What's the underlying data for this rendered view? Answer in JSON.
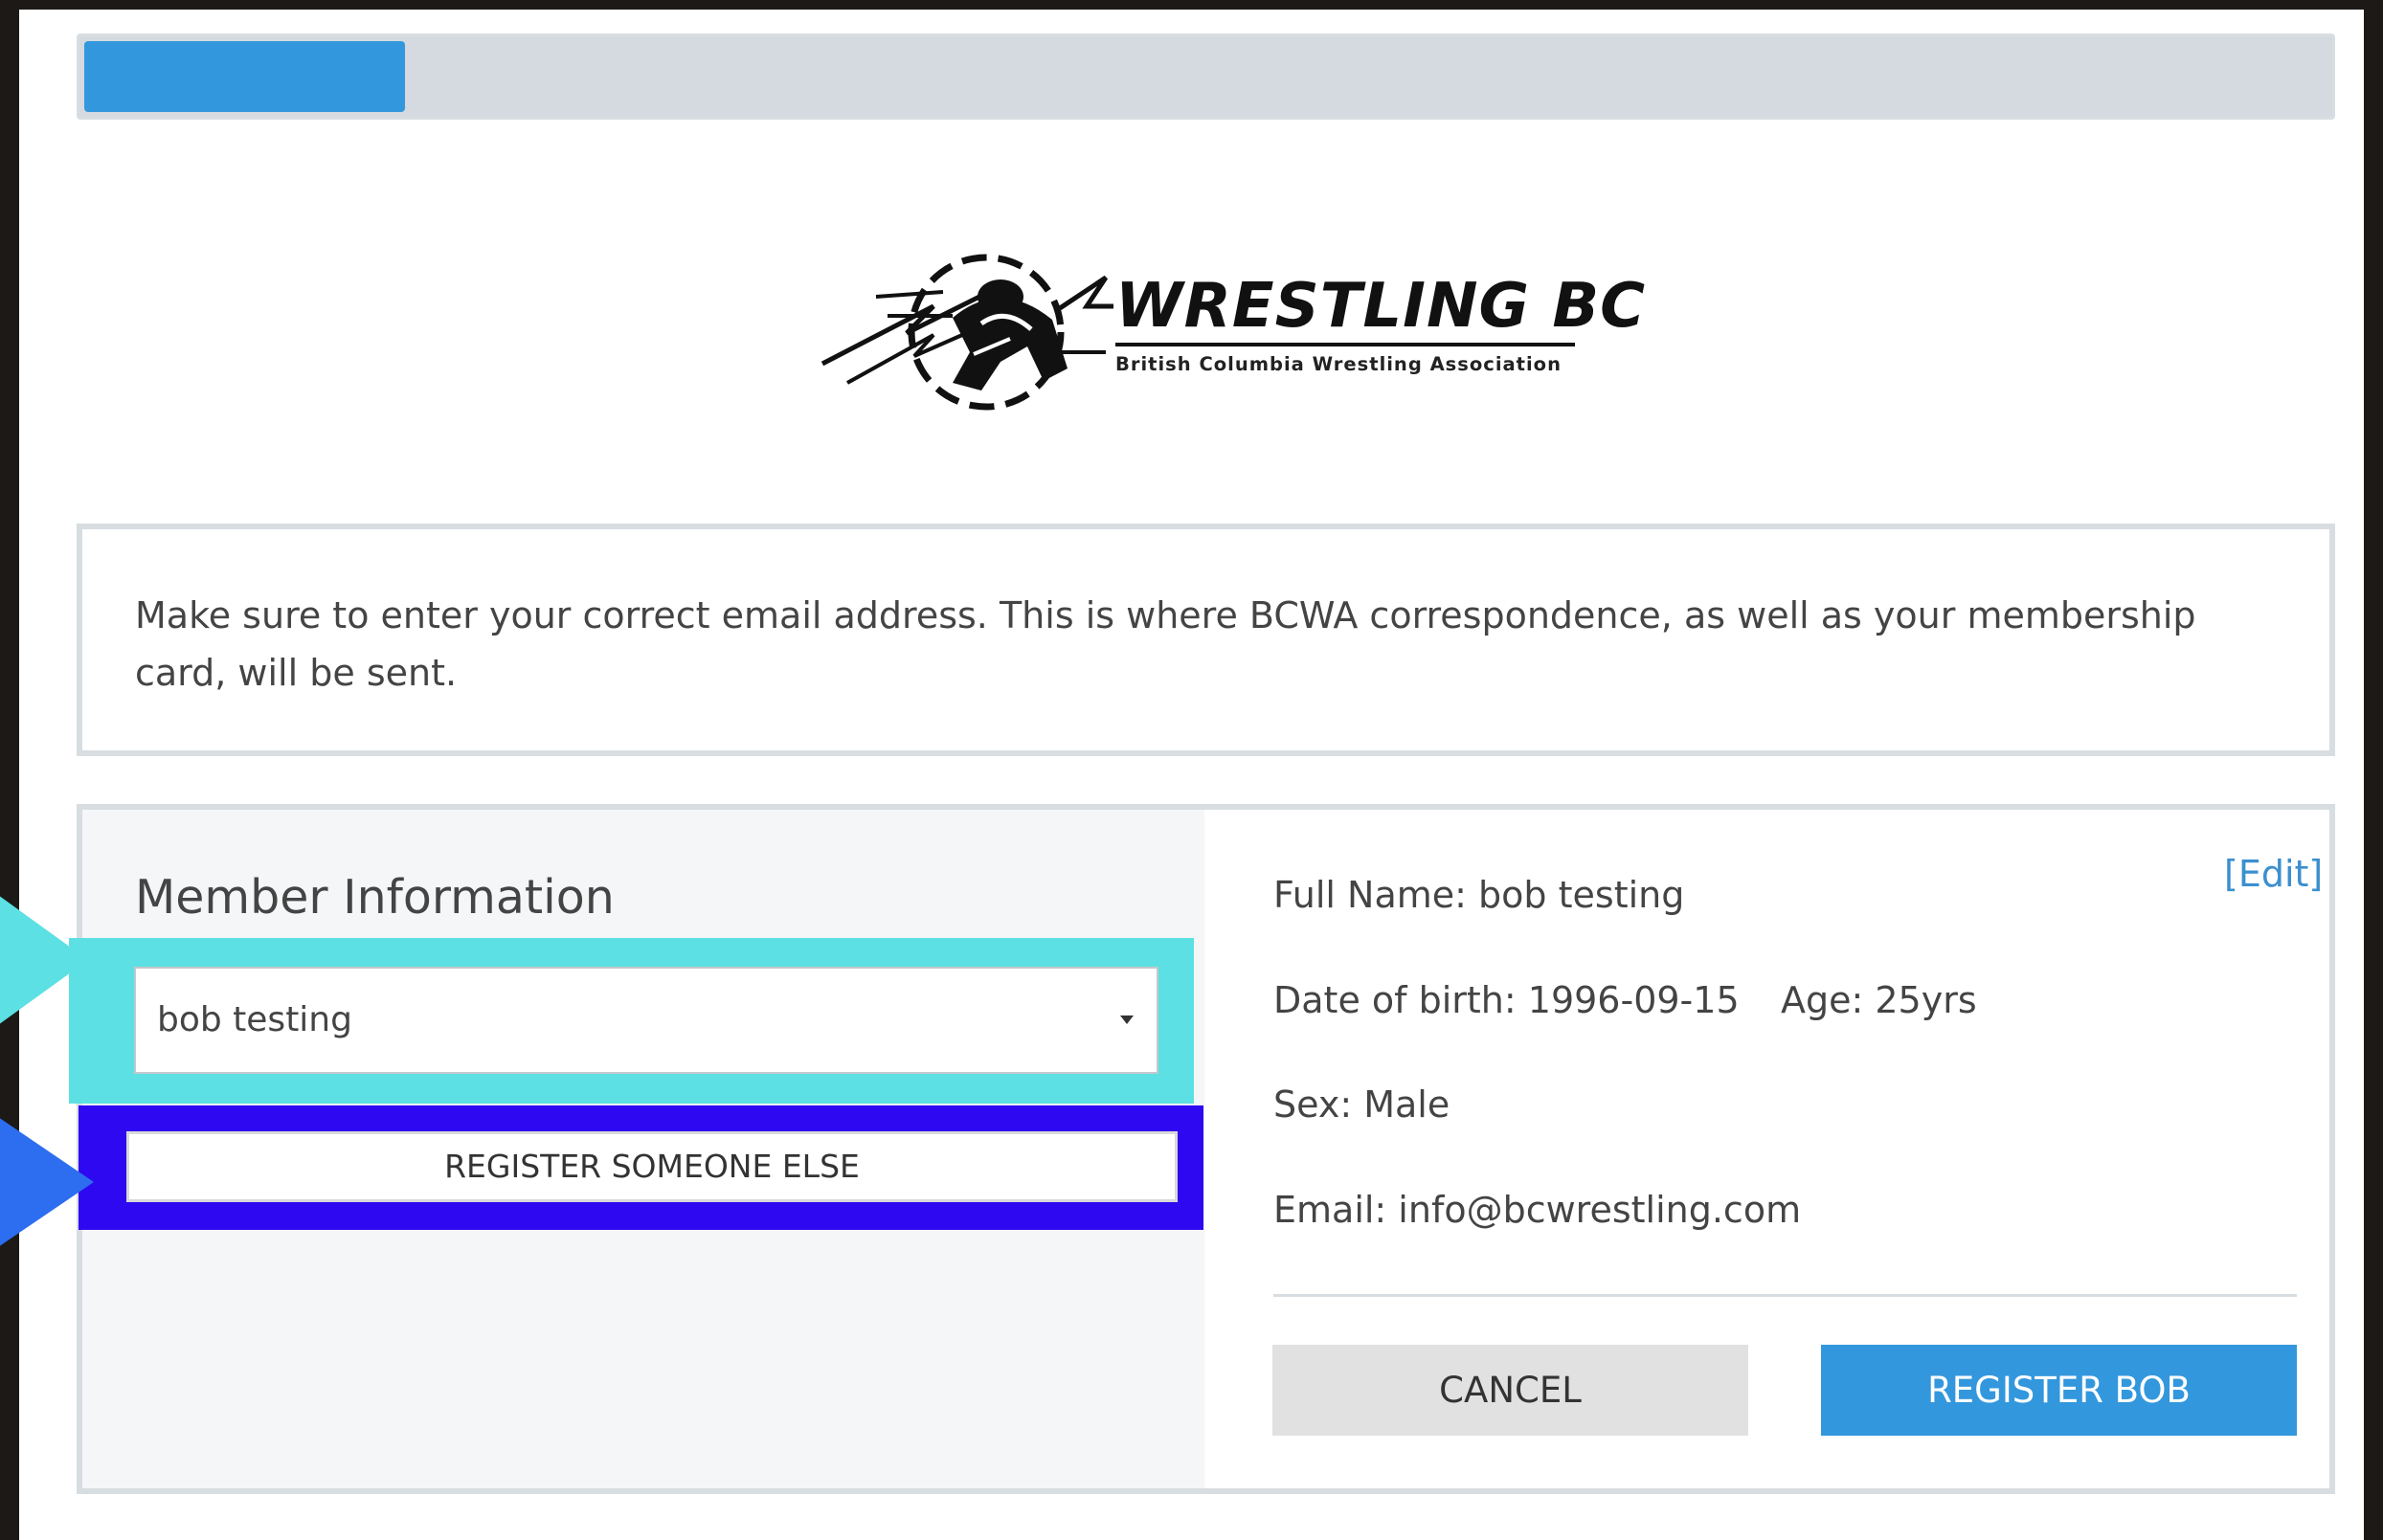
{
  "progress": {
    "fraction": 0.143
  },
  "logo": {
    "title": "WRESTLING BC",
    "subtitle": "British Columbia Wrestling Association",
    "icon": "wrestlers-emblem-icon"
  },
  "notice": {
    "text": "Make sure to enter your correct email address. This is where BCWA correspondence, as well as your membership card, will be sent."
  },
  "member_info": {
    "heading": "Member Information",
    "selected_member": "bob testing",
    "register_else_label": "REGISTER SOMEONE ELSE",
    "edit_label": "[Edit]",
    "details": {
      "full_name": "Full Name: bob testing",
      "dob": "Date of birth: 1996-09-15",
      "age": "Age: 25yrs",
      "sex": "Sex: Male",
      "email": "Email: info@bcwrestling.com"
    },
    "cancel_label": "CANCEL",
    "register_label": "REGISTER BOB"
  },
  "colors": {
    "accent": "#3397dd",
    "highlight_cyan": "#5ce0e3",
    "highlight_blue": "#2d08f0"
  },
  "annotations": {
    "arrow_1": "cyan-pointer-arrow-icon",
    "arrow_2": "blue-pointer-arrow-icon"
  }
}
